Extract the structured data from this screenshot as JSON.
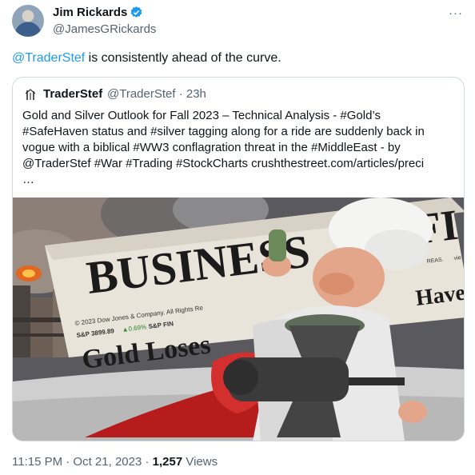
{
  "author": {
    "name": "Jim Rickards",
    "handle": "@JamesGRickards"
  },
  "menu": {
    "more_label": "···"
  },
  "tweet": {
    "mention": "@TraderStef",
    "text": " is consistently ahead of the curve."
  },
  "quote": {
    "name": "TraderStef",
    "handle_time": "@TraderStef · 23h",
    "lines": [
      "Gold and Silver Outlook for Fall 2023 – Technical Analysis - #Gold’s",
      "#SafeHaven status and #silver tagging along for a ride are suddenly back in",
      "vogue with a biblical #WW3 conflagration threat in the #MiddleEast - by",
      "@TraderStef #War #Trading #StockCharts  crushthestreet.com/articles/preci",
      "…"
    ],
    "image": {
      "headline": "BUSINESS",
      "headline_right": "FI",
      "subheadline": "Gold Loses",
      "side_headline": "Haven",
      "copyright": "© 2023 Dow Jones & Company. All Rights Re",
      "ticker_sp": "S&P 3899.89",
      "ticker_chg": "▲0.69%",
      "ticker_fin": "S&P FIN",
      "small_text": "REAS.",
      "small_text2": "vie"
    }
  },
  "meta": {
    "time_date": "11:15 PM · Oct 21, 2023 · ",
    "views_count": "1,257",
    "views_label": " Views"
  },
  "colors": {
    "accent": "#1d9bf0",
    "secondary_text": "#536471",
    "border": "#cfd9de"
  }
}
